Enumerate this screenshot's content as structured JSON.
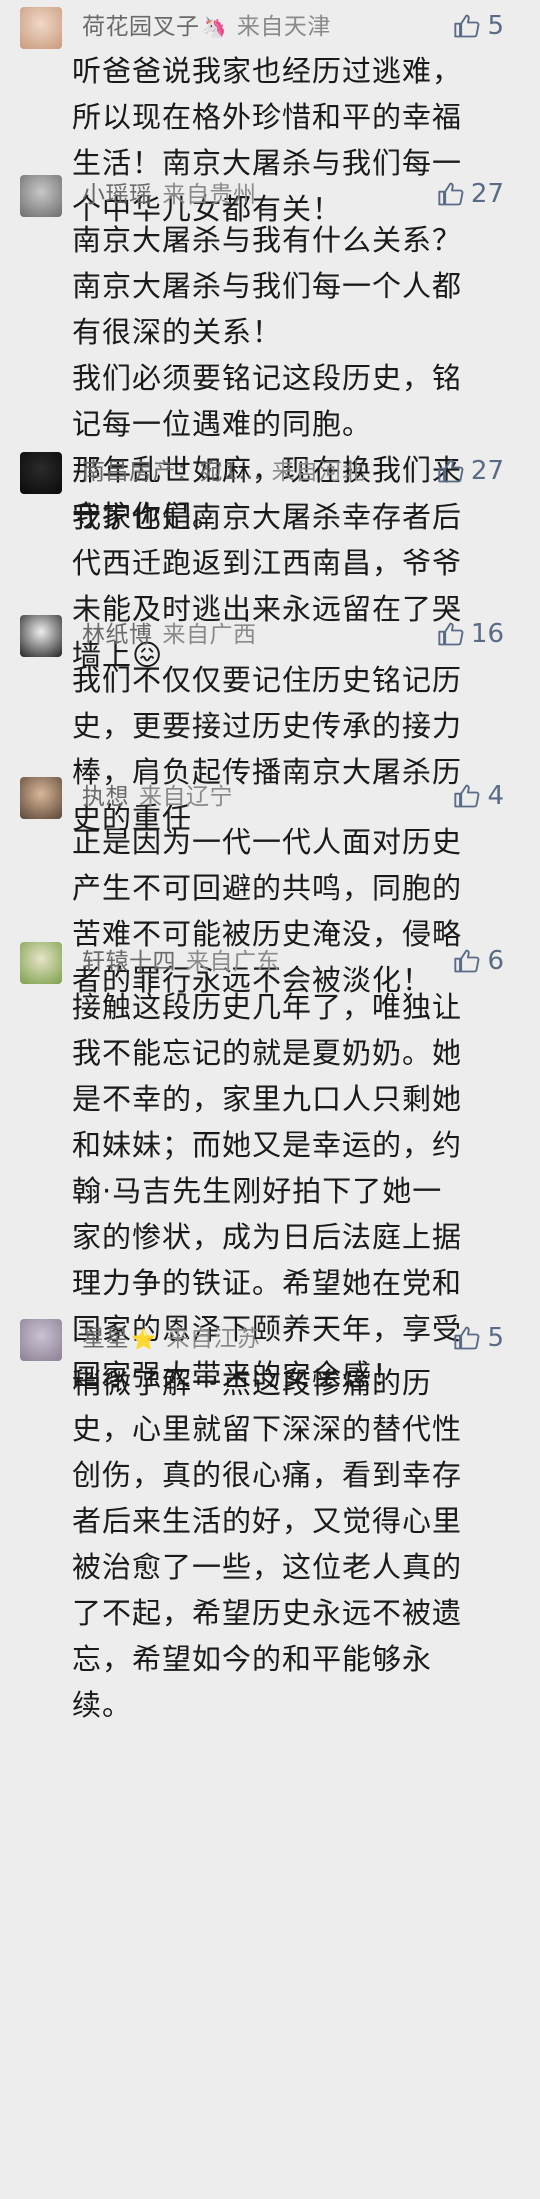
{
  "comments": [
    {
      "nickname": "荷花园叉子",
      "badge": "🦄",
      "region": "来自天津",
      "likes": "5",
      "lines": [
        "听爸爸说我家也经历过逃难，所以现在格外珍惜和平的幸福生活！南京大屠杀与我们每一个中华儿女都有关！"
      ],
      "avatar_colors": [
        "#f0d8c8",
        "#c99a7c"
      ]
    },
    {
      "nickname": "小瑶瑶",
      "badge": "",
      "region": "来自贵州",
      "likes": "27",
      "lines": [
        "南京大屠杀与我有什么关系？",
        "南京大屠杀与我们每一个人都有很深的关系！",
        "我们必须要铭记这段历史，铭记每一位遇难的同胞。",
        "那年乱世如麻，现在换我们来守护你们。"
      ],
      "avatar_colors": [
        "#c8c8c8",
        "#6c6c6c"
      ]
    },
    {
      "nickname": "南昌房产：宛1…",
      "badge": "",
      "region": "来自河北",
      "likes": "27",
      "lines": [
        "我家也是南京大屠杀幸存者后代西迁跑返到江西南昌，爷爷未能及时逃出来永远留在了哭墙上😖"
      ],
      "avatar_colors": [
        "#2a2a2a",
        "#0a0a0a"
      ]
    },
    {
      "nickname": "林纸博",
      "badge": "",
      "region": "来自广西",
      "likes": "16",
      "lines": [
        "我们不仅仅要记住历史铭记历史，更要接过历史传承的接力棒，肩负起传播南京大屠杀历史的重任"
      ],
      "avatar_colors": [
        "#eeeeee",
        "#222222"
      ]
    },
    {
      "nickname": "执想",
      "badge": "",
      "region": "来自辽宁",
      "likes": "4",
      "lines": [
        "正是因为一代一代人面对历史产生不可回避的共鸣，同胞的苦难不可能被历史淹没，侵略者的罪行永远不会被淡化！"
      ],
      "avatar_colors": [
        "#d9b79a",
        "#5b4636"
      ]
    },
    {
      "nickname": "轩辕十四",
      "badge": "",
      "region": "来自广东",
      "likes": "6",
      "lines": [
        "接触这段历史几年了，唯独让我不能忘记的就是夏奶奶。她是不幸的，家里九口人只剩她和妹妹；而她又是幸运的，约翰·马吉先生刚好拍下了她一家的惨状，成为日后法庭上据理力争的铁证。希望她在党和国家的恩泽下颐养天年，享受国家强大带来的安全感！"
      ],
      "avatar_colors": [
        "#e8e3c8",
        "#7aa04a"
      ]
    },
    {
      "nickname": "星星",
      "badge": "⭐",
      "region": "来自江苏",
      "likes": "5",
      "lines": [
        "稍微了解一点这段惨痛的历史，心里就留下深深的替代性创伤，真的很心痛，看到幸存者后来生活的好，又觉得心里被治愈了一些，这位老人真的了不起，希望历史永远不被遗忘，希望如今的和平能够永续。"
      ],
      "avatar_colors": [
        "#c9c3d2",
        "#8c7f93"
      ]
    }
  ],
  "colors": {
    "background": "#ededed",
    "text": "#1a1a1a",
    "meta": "#7b7b7b",
    "likes": "#5a6b86"
  },
  "icons": {
    "like": "thumbs-up-icon"
  }
}
